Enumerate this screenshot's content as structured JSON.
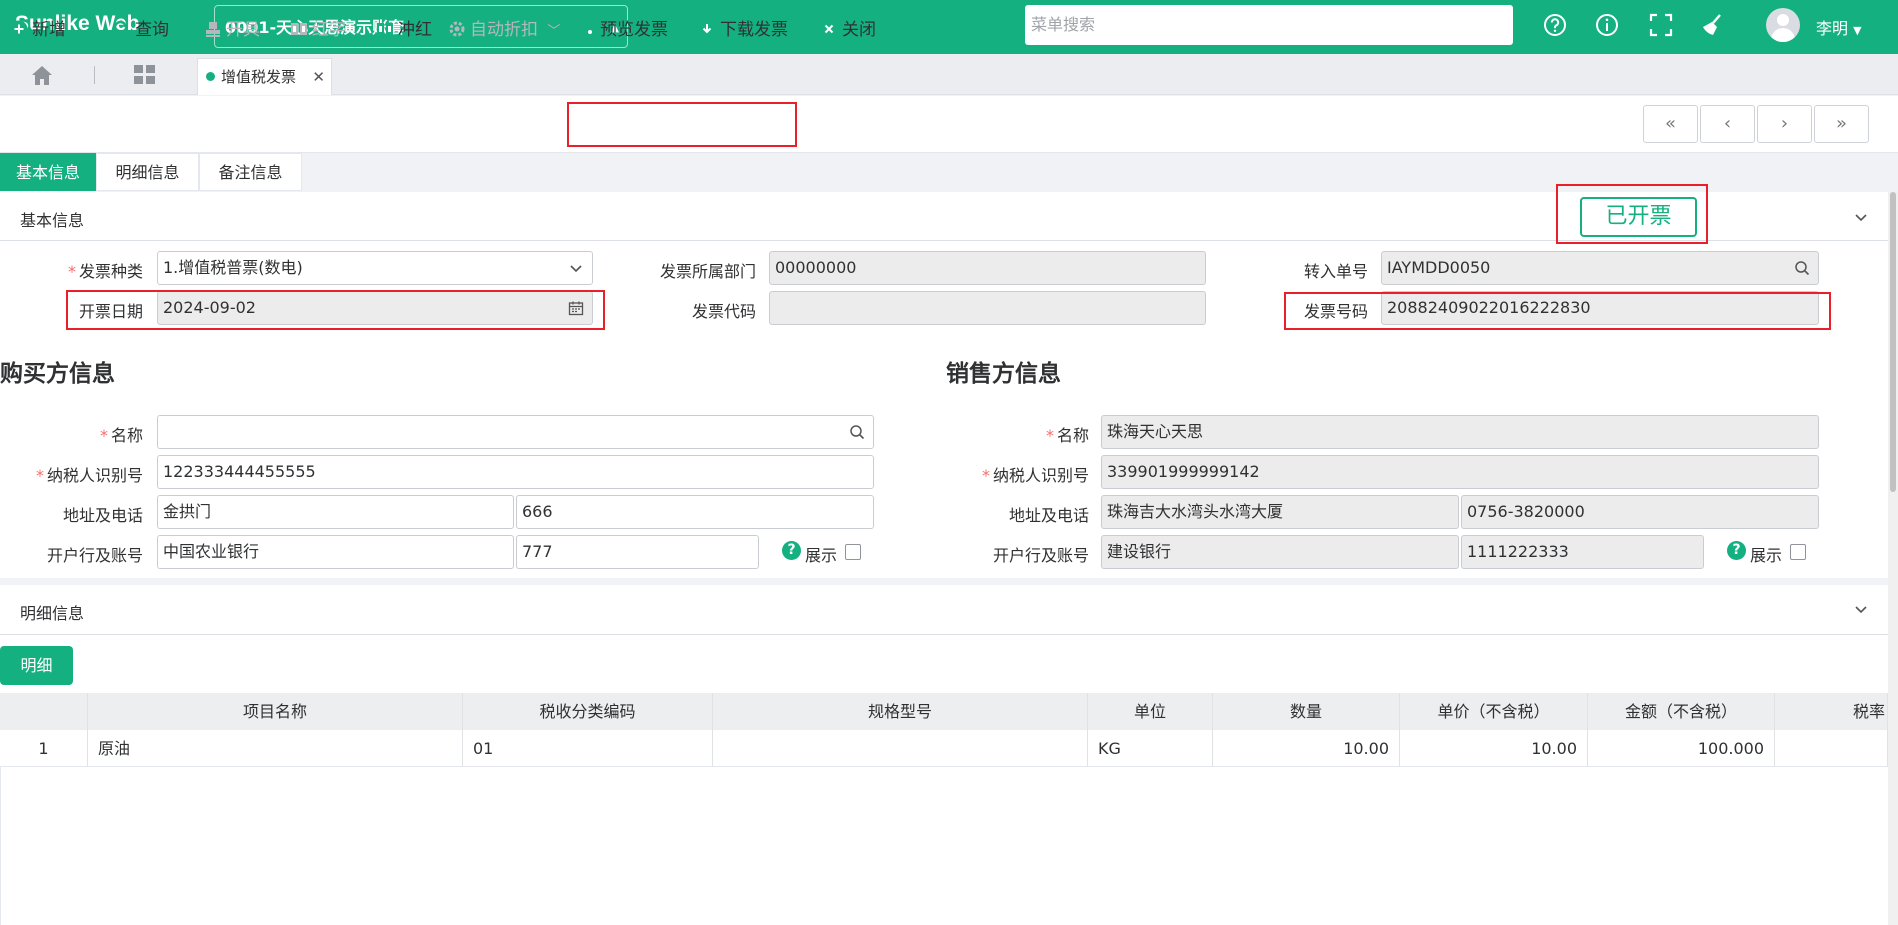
{
  "header": {
    "logo": "Sunlike Web",
    "account": "0001-天心天思演示账套",
    "search_placeholder": "菜单搜索",
    "user": "李明"
  },
  "tabs": {
    "active": "增值税发票"
  },
  "toolbar": {
    "new": "新增",
    "query": "查询",
    "issue": "开具",
    "red": "红字",
    "offset": "冲红",
    "auto_discount": "自动折扣",
    "preview": "预览发票",
    "download": "下载发票",
    "close": "关闭"
  },
  "subtabs": [
    "基本信息",
    "明细信息",
    "备注信息"
  ],
  "basic": {
    "section_title": "基本信息",
    "status": "已开票",
    "invoice_type_label": "发票种类",
    "invoice_type": "1.增值税普票(数电)",
    "invoice_date_label": "开票日期",
    "invoice_date": "2024-09-02",
    "dept_label": "发票所属部门",
    "dept": "00000000",
    "code_label": "发票代码",
    "code": "",
    "transfer_label": "转入单号",
    "transfer": "IAYMDD0050",
    "number_label": "发票号码",
    "number": "20882409022016222830"
  },
  "buyer": {
    "title": "购买方信息",
    "name_label": "名称",
    "name": "",
    "tax_label": "纳税人识别号",
    "tax": "122333444455555",
    "addr_label": "地址及电话",
    "addr": "金拱门",
    "phone": "666",
    "bank_label": "开户行及账号",
    "bank": "中国农业银行",
    "account": "777",
    "show_label": "展示"
  },
  "seller": {
    "title": "销售方信息",
    "name_label": "名称",
    "name": "珠海天心天思",
    "tax_label": "纳税人识别号",
    "tax": "339901999999142",
    "addr_label": "地址及电话",
    "addr": "珠海吉大水湾头水湾大厦",
    "phone": "0756-3820000",
    "bank_label": "开户行及账号",
    "bank": "建设银行",
    "account": "1111222333",
    "show_label": "展示"
  },
  "detail": {
    "section_title": "明细信息",
    "button": "明细",
    "headers": [
      "",
      "项目名称",
      "税收分类编码",
      "规格型号",
      "单位",
      "数量",
      "单价（不含税）",
      "金额（不含税）",
      "税率"
    ],
    "rows": [
      [
        "1",
        "原油",
        "01",
        "",
        "KG",
        "10.00",
        "10.00",
        "100.000",
        ""
      ]
    ]
  },
  "colors": {
    "brand": "#14b07f",
    "highlight": "#e8202a"
  }
}
